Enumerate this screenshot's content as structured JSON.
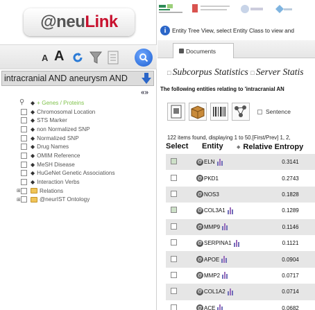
{
  "logo": {
    "prefix": "@neu",
    "suffix": "Link"
  },
  "toolbar": {
    "font_small": "A",
    "font_large": "A"
  },
  "query": {
    "text": "intracranial AND aneurysm AND"
  },
  "collapse_label": "«»",
  "tree": [
    {
      "label": "+ Genes / Proteins",
      "highlight": true
    },
    {
      "label": "Chromosomal Location"
    },
    {
      "label": "STS Marker"
    },
    {
      "label": "non Normalized SNP"
    },
    {
      "label": "Normalized SNP"
    },
    {
      "label": "Drug Names"
    },
    {
      "label": "OMIM Reference"
    },
    {
      "label": "MeSH Disease"
    },
    {
      "label": "HuGeNet Genetic Associations"
    },
    {
      "label": "Interaction Verbs"
    },
    {
      "label": "Relations",
      "folder": true
    },
    {
      "label": "@neurIST Ontology",
      "folder": true
    }
  ],
  "message": "Entity Tree View, select Entity Class to view and",
  "tabs": {
    "documents": "Documents"
  },
  "stats": {
    "subcorpus": "Subcorpus Statistics",
    "server": "Server Statis"
  },
  "following": "The following entities relating to 'intracranial AN",
  "sentence_label": "Sentence",
  "items_found": "122 items found, displaying 1 to 50.[First/Prev] 1, 2,",
  "table": {
    "headers": {
      "select": "Select",
      "entity": "Entity",
      "entropy": "Relative Entropy"
    },
    "rows": [
      {
        "entity": "ELN",
        "value": "0.3141"
      },
      {
        "entity": "PKD1",
        "value": "0.2743"
      },
      {
        "entity": "NOS3",
        "value": "0.1828"
      },
      {
        "entity": "COL3A1",
        "value": "0.1289"
      },
      {
        "entity": "MMP9",
        "value": "0.1146"
      },
      {
        "entity": "SERPINA1",
        "value": "0.1121"
      },
      {
        "entity": "APOE",
        "value": "0.0904"
      },
      {
        "entity": "MMP2",
        "value": "0.0717"
      },
      {
        "entity": "COL1A2",
        "value": "0.0714"
      },
      {
        "entity": "ACE",
        "value": "0.0682"
      }
    ]
  },
  "colors": {
    "accent": "#c8102e",
    "highlight": "#7fc24a",
    "info": "#2b66c8"
  }
}
